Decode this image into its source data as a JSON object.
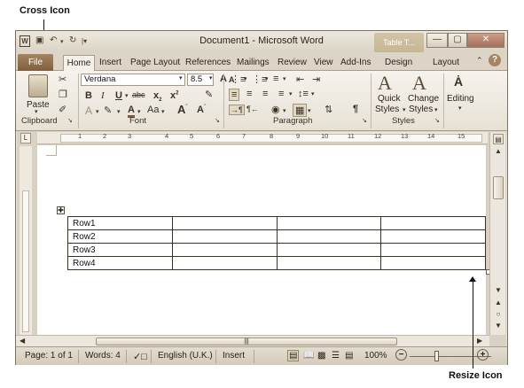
{
  "callouts": {
    "cross": "Cross Icon",
    "resize": "Resize Icon"
  },
  "titlebar": {
    "title": "Document1 - Microsoft Word",
    "contextual_tab": "Table T..."
  },
  "tabs": [
    "File",
    "Home",
    "Insert",
    "Page Layout",
    "References",
    "Mailings",
    "Review",
    "View",
    "Add-Ins",
    "Design",
    "Layout"
  ],
  "ribbon": {
    "clipboard": {
      "paste": "Paste",
      "label": "Clipboard"
    },
    "font": {
      "name": "Verdana",
      "size": "8.5",
      "label": "Font"
    },
    "paragraph": {
      "label": "Paragraph"
    },
    "styles": {
      "quick": "Quick",
      "quick2": "Styles",
      "change": "Change",
      "change2": "Styles",
      "label": "Styles"
    },
    "editing": {
      "label": "Editing"
    }
  },
  "ruler": [
    "1",
    "2",
    "3",
    "4",
    "5",
    "6",
    "7",
    "8",
    "9",
    "10",
    "11",
    "12",
    "13",
    "14",
    "15"
  ],
  "table": {
    "rows": [
      [
        "Row1",
        "",
        "",
        ""
      ],
      [
        "Row2",
        "",
        "",
        ""
      ],
      [
        "Row3",
        "",
        "",
        ""
      ],
      [
        "Row4",
        "",
        "",
        ""
      ]
    ]
  },
  "status": {
    "page": "Page: 1 of 1",
    "words": "Words: 4",
    "language": "English (U.K.)",
    "mode": "Insert",
    "zoom": "100%",
    "zoom_level": 1.0
  }
}
